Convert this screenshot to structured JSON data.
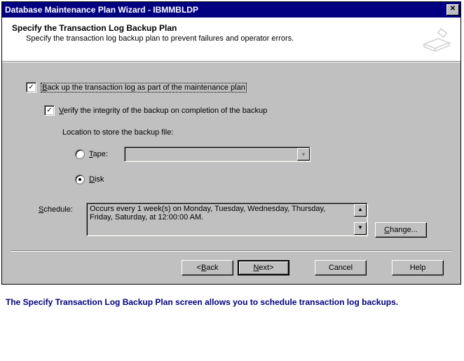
{
  "titlebar": {
    "title": "Database Maintenance Plan Wizard - IBMMBLDP",
    "close_glyph": "✕"
  },
  "header": {
    "title": "Specify the Transaction Log Backup Plan",
    "subtitle": "Specify the transaction log backup plan to prevent failures and operator errors."
  },
  "main": {
    "backup_checkbox": {
      "checked": true,
      "label_pre": "B",
      "label_post": "ack up the transaction log as part of the maintenance plan"
    },
    "verify_checkbox": {
      "checked": true,
      "label_pre": "V",
      "label_post": "erify the integrity of the backup on completion of the backup"
    },
    "location_label": "Location to store the backup file:",
    "tape": {
      "selected": false,
      "label_pre": "T",
      "label_post": "ape:"
    },
    "disk": {
      "selected": true,
      "label_pre": "D",
      "label_post": "isk"
    },
    "dropdown_arrow": "▼",
    "schedule": {
      "label_pre": "S",
      "label_post": "chedule:",
      "text": "Occurs every 1 week(s) on Monday, Tuesday, Wednesday, Thursday, Friday, Saturday, at 12:00:00 AM.",
      "up": "▲",
      "down": "▼"
    },
    "change_btn_pre": "C",
    "change_btn_post": "hange..."
  },
  "buttons": {
    "back_arrow": "< ",
    "back_pre": "B",
    "back_post": "ack",
    "next_pre": "N",
    "next_post": "ext",
    "next_arrow": " >",
    "cancel": "Cancel",
    "help": "Help"
  },
  "caption": "The Specify Transaction Log Backup Plan screen allows you to schedule transaction log backups."
}
